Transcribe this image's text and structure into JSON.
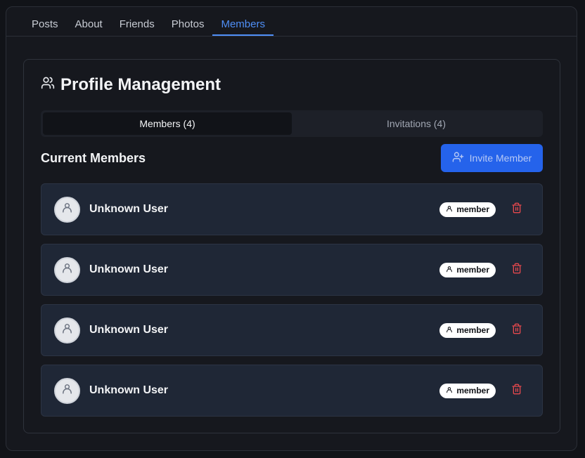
{
  "nav": {
    "tabs": [
      "Posts",
      "About",
      "Friends",
      "Photos",
      "Members"
    ],
    "active_index": 4
  },
  "card": {
    "title": "Profile Management",
    "title_icon": "users-icon"
  },
  "segments": {
    "members_label": "Members (4)",
    "invitations_label": "Invitations (4)",
    "active": "members"
  },
  "section": {
    "title": "Current Members",
    "invite_label": "Invite Member",
    "invite_icon": "user-plus-icon"
  },
  "members": [
    {
      "name": "Unknown User",
      "role": "member"
    },
    {
      "name": "Unknown User",
      "role": "member"
    },
    {
      "name": "Unknown User",
      "role": "member"
    },
    {
      "name": "Unknown User",
      "role": "member"
    }
  ],
  "colors": {
    "accent": "#4f8ff7",
    "primary_button": "#2563eb",
    "danger": "#e5484d",
    "member_row": "#1f2736"
  }
}
